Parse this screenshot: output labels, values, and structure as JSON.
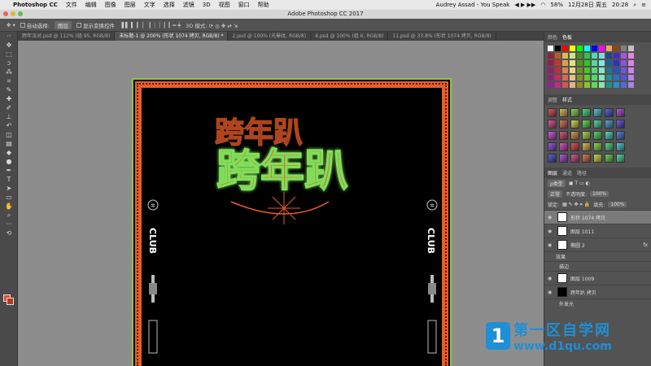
{
  "menubar": {
    "app": "Photoshop CC",
    "items": [
      "文件",
      "编辑",
      "图像",
      "图层",
      "文字",
      "选择",
      "滤镜",
      "3D",
      "视图",
      "窗口",
      "帮助"
    ],
    "now_playing": "Audrey Assad - You Speak",
    "battery": "58%",
    "date": "12月28日 周五",
    "time": "20:28"
  },
  "window": {
    "title": "Adobe Photoshop CC 2017"
  },
  "options": {
    "auto_select_label": "自动选择:",
    "auto_select_value": "图层",
    "show_transform_label": "显示变换控件"
  },
  "tabs": [
    "跨年派对.psd @ 112% (组 95, RGB/8)",
    "未标题-1 @ 200% (形状 1074 拷贝, RGB/8) *",
    "2.psd @ 100% (光晕纹, RGB/8)",
    "4.psd @ 100% (组 6, RGB/8)",
    "11.psd @ 33.8% (形状 1074 拷贝, RGB/8)"
  ],
  "canvas": {
    "headline": "跨年趴",
    "side_text": "CLUB"
  },
  "panels": {
    "color_tabs": [
      "颜色",
      "色板"
    ],
    "adjust_tabs": [
      "调整",
      "样式"
    ],
    "layers_tabs": [
      "图层",
      "通道",
      "路径"
    ],
    "filter_label": "ρ类型",
    "blend_mode": "正常",
    "opacity_label": "不透明度:",
    "opacity_value": "100%",
    "lock_label": "锁定:",
    "fill_label": "填充:",
    "fill_value": "100%",
    "layers": [
      {
        "name": "形状 1074 拷贝",
        "selected": true
      },
      {
        "name": "图层 1011",
        "selected": false
      },
      {
        "name": "椭圆 2",
        "selected": false
      },
      {
        "name": "效果",
        "selected": false
      },
      {
        "name": "描边",
        "selected": false
      },
      {
        "name": "图层 1009",
        "selected": false
      },
      {
        "name": "跨年趴 拷贝",
        "selected": false
      },
      {
        "name": "外发光",
        "selected": false
      }
    ]
  },
  "watermark": {
    "line1": "第一区自学网",
    "line2": "www.d1qu.com",
    "logo": "1"
  },
  "colors": {
    "accent": "#e85d2a",
    "doc_border": "#8fc14a",
    "brand_blue": "#1f8fd6"
  }
}
